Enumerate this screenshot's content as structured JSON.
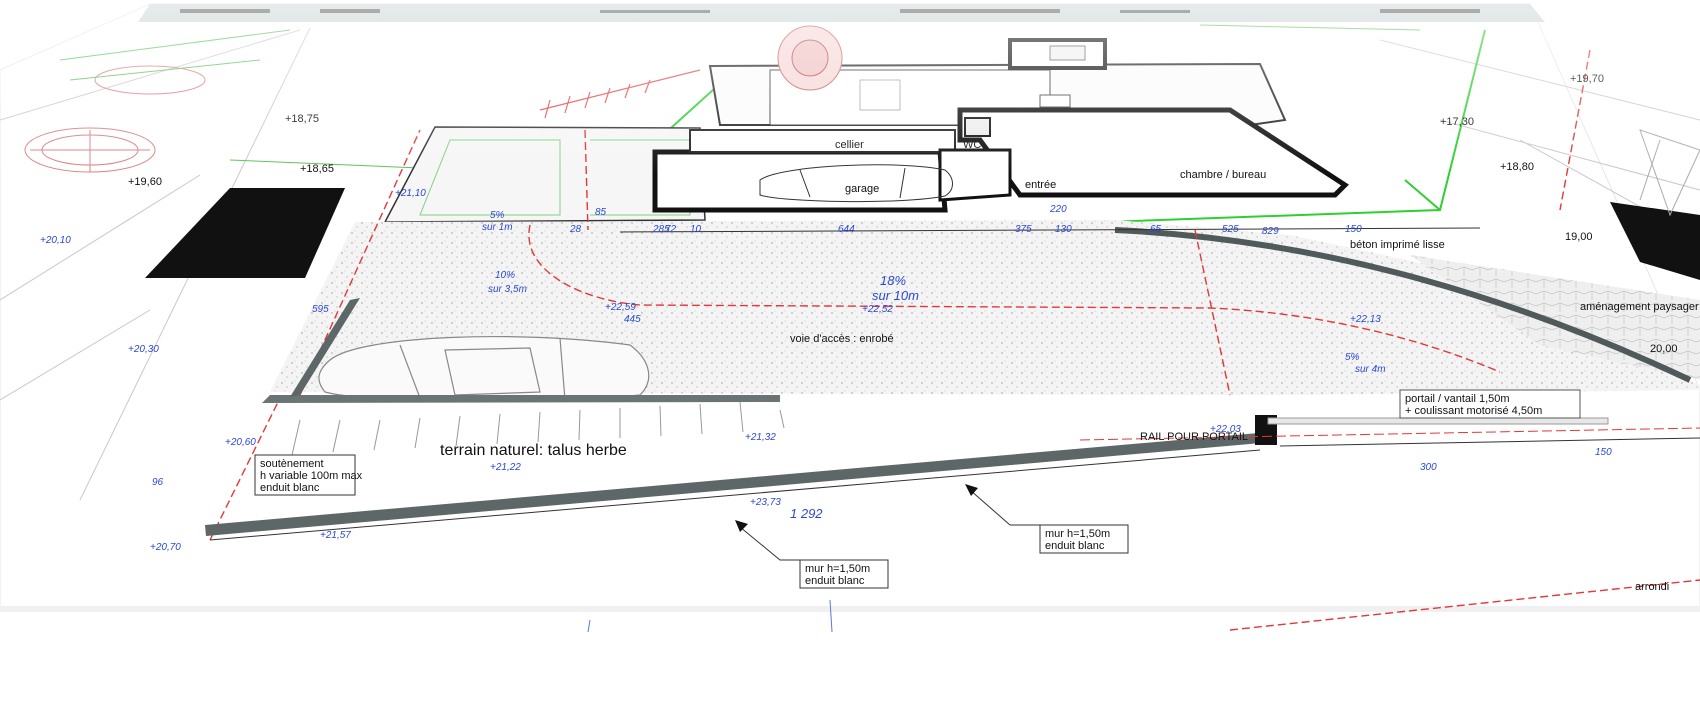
{
  "plan": {
    "driveway_label": "voie d'accès : enrobé",
    "garage_label": "garage",
    "room_bedroom": "chambre / bureau",
    "room_entry": "entrée",
    "room_cellier": "cellier",
    "room_wc": "WC",
    "slope_main": "18%",
    "slope_main_len": "sur 10m",
    "slope_left": "10%",
    "slope_left_len": "sur 3,5m",
    "slope_small": "5%",
    "slope_small_len": "sur 1m",
    "slope_right": "5%",
    "slope_right_len": "sur 4m",
    "terrain_label": "terrain naturel: talus herbe",
    "wall_note_1_line1": "mur h=1,50m",
    "wall_note_1_line2": "enduit blanc",
    "wall_note_2_line1": "mur h=1,50m",
    "wall_note_2_line2": "enduit blanc",
    "retaining_line1": "soutènement",
    "retaining_line2": "h variable 100m max",
    "retaining_line3": "enduit blanc",
    "gate_note_line1": "portail / vantail 1,50m",
    "gate_note_line2": "+ coulissant motorisé 4,50m",
    "portal_label": "RAIL POUR PORTAIL",
    "side_label_right": "aménagement paysager",
    "under_building_label": "béton imprimé lisse",
    "dim_1292": "1 292",
    "dim_644": "644",
    "dim_300": "300",
    "dim_150": "150",
    "dim_1900": "19,00",
    "dim_2000": "20,00",
    "corner_text": "arrondi",
    "elev": [
      "+20,70",
      "+21,57",
      "+21,22",
      "+21,32",
      "+22,03",
      "+22,13",
      "+23,73",
      "+22,59",
      "+22,52",
      "+20,60",
      "+21,10",
      "+20,30",
      "+20,10",
      "+19,60",
      "+18,75",
      "+18,65",
      "+18,80",
      "+19,70",
      "+17,30"
    ],
    "dims_small": [
      "130",
      "220",
      "829",
      "375",
      "150",
      "285",
      "28",
      "10",
      "72",
      "85",
      "445",
      "595",
      "65",
      "525",
      "96"
    ]
  }
}
